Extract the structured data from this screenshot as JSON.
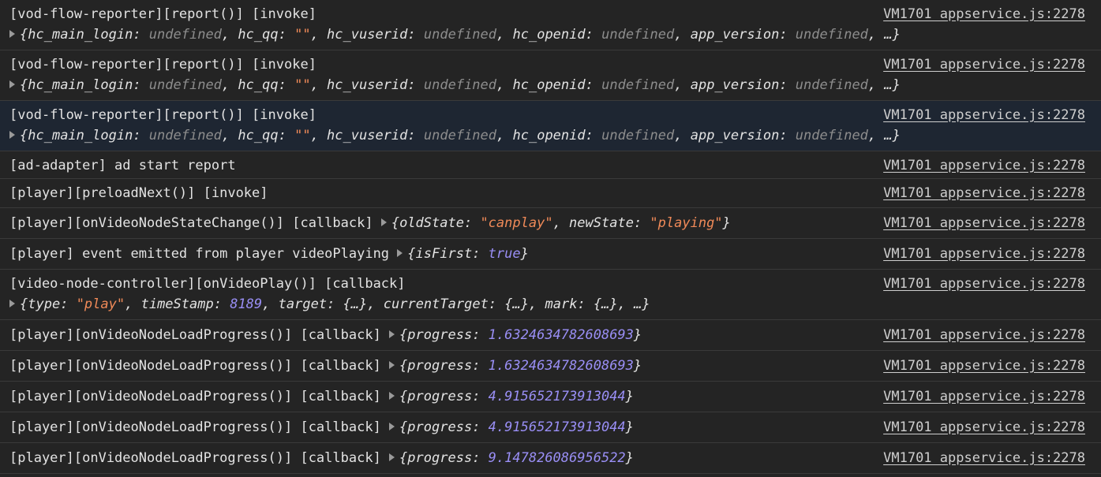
{
  "source_link": "VM1701 appservice.js:2278",
  "rows": [
    {
      "message": "[vod-flow-reporter][report()] [invoke]",
      "obj": {
        "k1": "hc_main_login",
        "v1": "undefined",
        "k2": "hc_qq",
        "v2": "\"\"",
        "k3": "hc_vuserid",
        "v3": "undefined",
        "k4": "hc_openid",
        "v4": "undefined",
        "k5": "app_version",
        "v5": "undefined",
        "tail": ", …}"
      }
    },
    {
      "message": "[vod-flow-reporter][report()] [invoke]",
      "obj": {
        "k1": "hc_main_login",
        "v1": "undefined",
        "k2": "hc_qq",
        "v2": "\"\"",
        "k3": "hc_vuserid",
        "v3": "undefined",
        "k4": "hc_openid",
        "v4": "undefined",
        "k5": "app_version",
        "v5": "undefined",
        "tail": ", …}"
      }
    },
    {
      "message": "[vod-flow-reporter][report()] [invoke]",
      "obj": {
        "k1": "hc_main_login",
        "v1": "undefined",
        "k2": "hc_qq",
        "v2": "\"\"",
        "k3": "hc_vuserid",
        "v3": "undefined",
        "k4": "hc_openid",
        "v4": "undefined",
        "k5": "app_version",
        "v5": "undefined",
        "tail": ", …}"
      }
    },
    {
      "message": "[ad-adapter] ad start report"
    },
    {
      "message": "[player][preloadNext()] [invoke]"
    },
    {
      "message": "[player][onVideoNodeStateChange()] [callback] ",
      "k1": "oldState",
      "v1": "\"canplay\"",
      "k2": "newState",
      "v2": "\"playing\""
    },
    {
      "message": "[player] event emitted from player videoPlaying ",
      "k1": "isFirst",
      "v1": "true"
    },
    {
      "message": "[video-node-controller][onVideoPlay()] [callback]",
      "k1": "type",
      "v1": "\"play\"",
      "k2": "timeStamp",
      "v2": "8189",
      "k3": "target",
      "v3": "{…}",
      "k4": "currentTarget",
      "v4": "{…}",
      "k5": "mark",
      "v5": "{…}",
      "tail": ", …}"
    },
    {
      "message": "[player][onVideoNodeLoadProgress()] [callback] ",
      "key": "progress",
      "value": "1.6324634782608693"
    },
    {
      "message": "[player][onVideoNodeLoadProgress()] [callback] ",
      "key": "progress",
      "value": "1.6324634782608693"
    },
    {
      "message": "[player][onVideoNodeLoadProgress()] [callback] ",
      "key": "progress",
      "value": "4.915652173913044"
    },
    {
      "message": "[player][onVideoNodeLoadProgress()] [callback] ",
      "key": "progress",
      "value": "4.915652173913044"
    },
    {
      "message": "[player][onVideoNodeLoadProgress()] [callback] ",
      "key": "progress",
      "value": "9.147826086956522"
    }
  ]
}
